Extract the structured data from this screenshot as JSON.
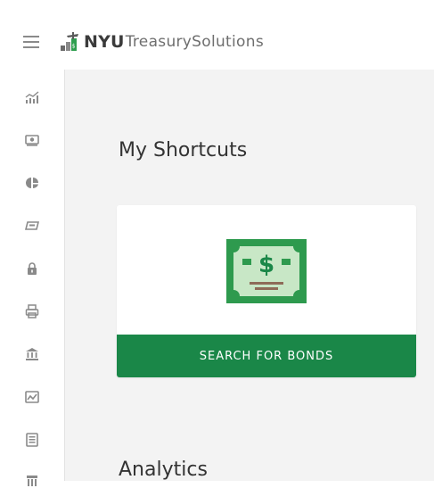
{
  "header": {
    "brand_bold": "NYU",
    "brand_rest": "TreasurySolutions"
  },
  "sidebar": {
    "items": [
      {
        "icon": "analytics-chart-icon"
      },
      {
        "icon": "money-icon"
      },
      {
        "icon": "pie-chart-icon"
      },
      {
        "icon": "ticket-icon"
      },
      {
        "icon": "lock-icon"
      },
      {
        "icon": "printer-icon"
      },
      {
        "icon": "bank-icon"
      },
      {
        "icon": "image-report-icon"
      },
      {
        "icon": "document-icon"
      },
      {
        "icon": "building-icon"
      }
    ]
  },
  "main": {
    "shortcuts_title": "My Shortcuts",
    "shortcut_card": {
      "icon": "dollar-bill-icon",
      "button_label": "SEARCH FOR BONDS"
    },
    "analytics_title": "Analytics"
  },
  "colors": {
    "accent_green": "#1a8748",
    "sidebar_icon_gray": "#8a8a8a",
    "main_background": "#f3f3f3"
  }
}
